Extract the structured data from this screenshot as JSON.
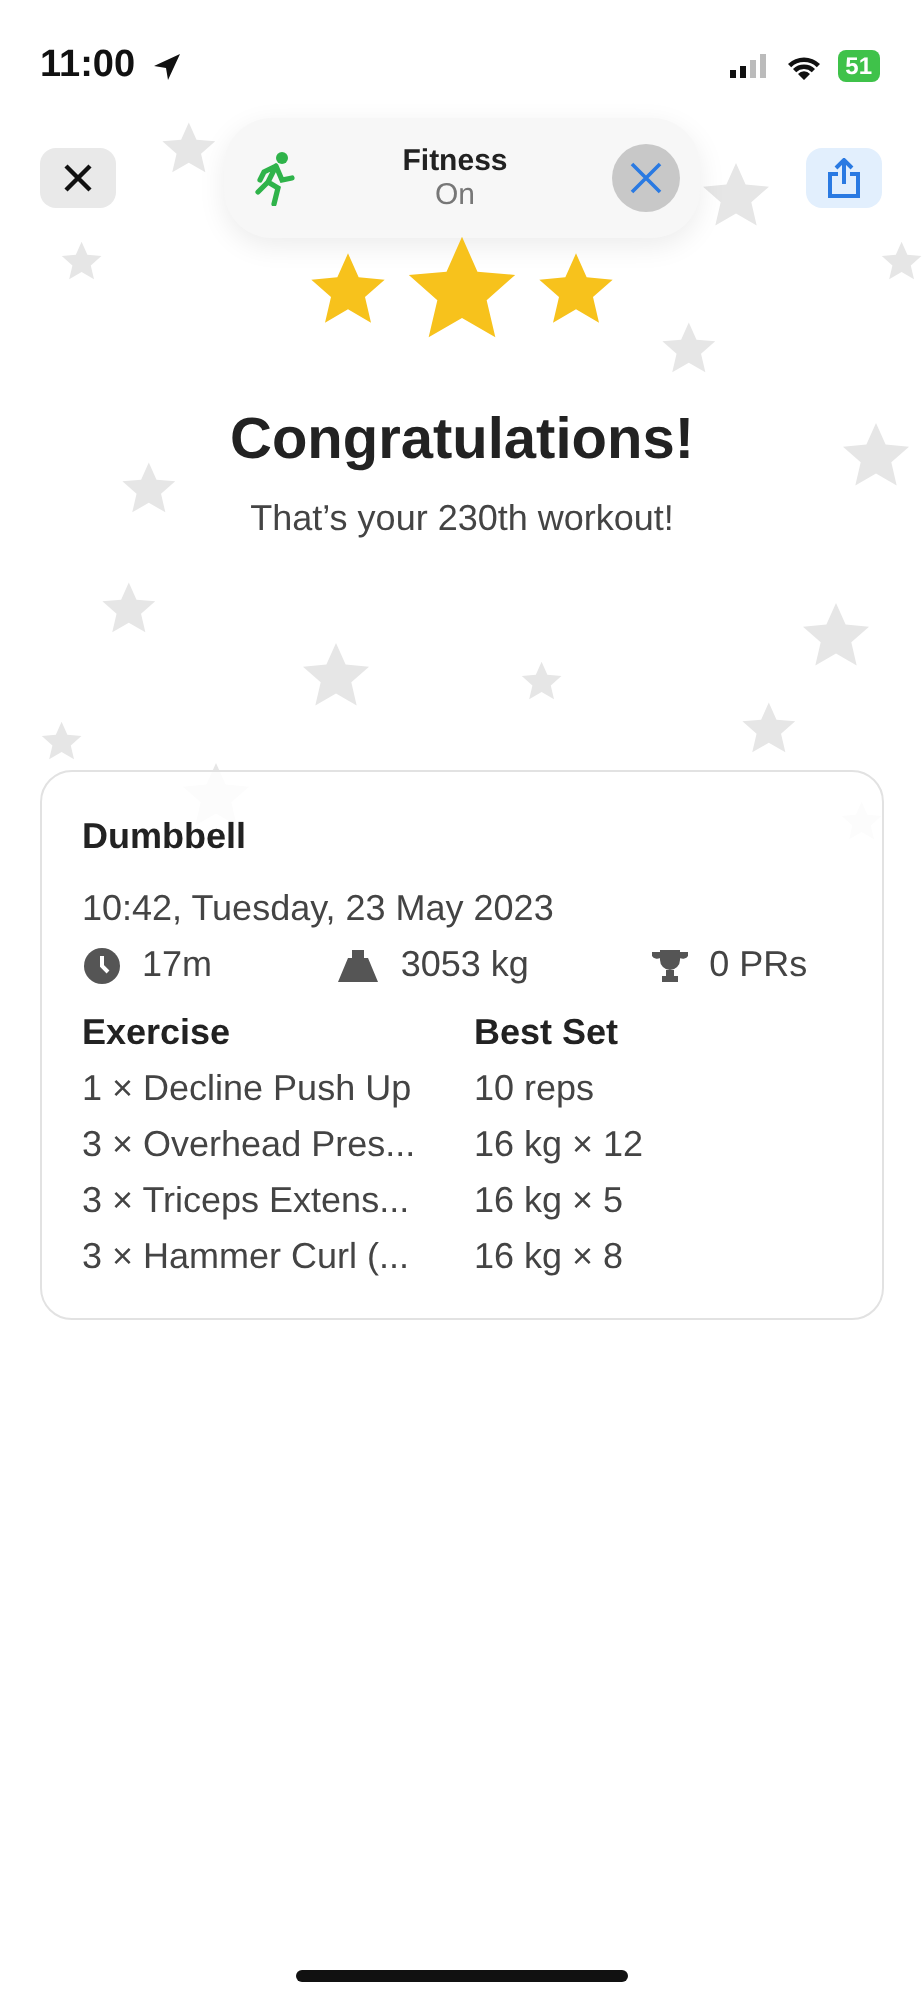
{
  "status_bar": {
    "time": "11:00",
    "battery": "51"
  },
  "focus_pill": {
    "title": "Fitness",
    "status": "On"
  },
  "heading": "Congratulations!",
  "subtitle": "That’s your 230th workout!",
  "workout": {
    "name": "Dumbbell",
    "date": "10:42, Tuesday, 23 May 2023",
    "stats": [
      {
        "kind": "duration",
        "value": "17m"
      },
      {
        "kind": "volume",
        "value": "3053 kg"
      },
      {
        "kind": "records",
        "value": "0 PRs"
      }
    ],
    "columns": [
      "Exercise",
      "Best Set"
    ],
    "rows": [
      [
        "1 × Decline Push Up",
        "10 reps"
      ],
      [
        "3 × Overhead Pres...",
        "16 kg × 12"
      ],
      [
        "3 × Triceps Extens...",
        "16 kg × 5"
      ],
      [
        "3 × Hammer Curl (...",
        "16 kg × 8"
      ]
    ]
  }
}
